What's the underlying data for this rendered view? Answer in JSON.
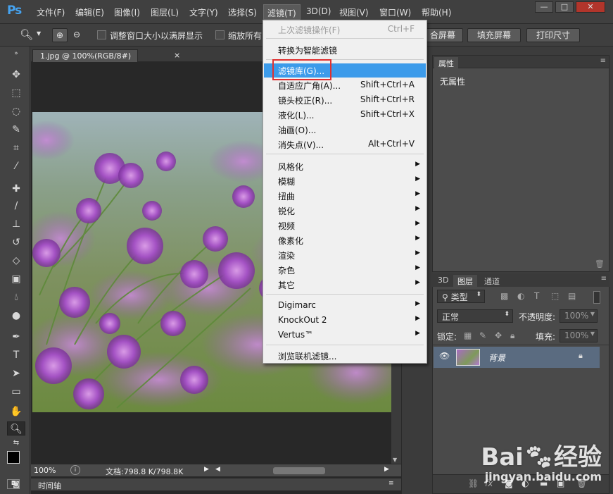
{
  "menubar": {
    "logo": "Ps",
    "items": [
      "文件(F)",
      "编辑(E)",
      "图像(I)",
      "图层(L)",
      "文字(Y)",
      "选择(S)",
      "滤镜(T)",
      "3D(D)",
      "视图(V)",
      "窗口(W)",
      "帮助(H)"
    ],
    "window_buttons": [
      "—",
      "□",
      "✕"
    ]
  },
  "options": {
    "check1_label": "调整窗口大小以满屏显示",
    "check2_label": "缩放所有",
    "btn_fit": "合屏幕",
    "btn_fill": "填充屏幕",
    "btn_print": "打印尺寸"
  },
  "document": {
    "tab_title": "1.jpg @ 100%(RGB/8#)",
    "tab_close": "×",
    "zoom": "100%",
    "doc_size": "文档:798.8 K/798.8K",
    "timeline_label": "时间轴"
  },
  "filter_menu": {
    "items": [
      {
        "label": "上次滤镜操作(F)",
        "shortcut": "Ctrl+F",
        "disabled": true
      },
      {
        "label": "转换为智能滤镜"
      },
      {
        "label": "滤镜库(G)..."
      },
      {
        "label": "自适应广角(A)...",
        "shortcut": "Shift+Ctrl+A"
      },
      {
        "label": "镜头校正(R)...",
        "shortcut": "Shift+Ctrl+R"
      },
      {
        "label": "液化(L)...",
        "shortcut": "Shift+Ctrl+X"
      },
      {
        "label": "油画(O)..."
      },
      {
        "label": "消失点(V)...",
        "shortcut": "Alt+Ctrl+V"
      },
      {
        "label": "风格化",
        "submenu": true
      },
      {
        "label": "模糊",
        "submenu": true
      },
      {
        "label": "扭曲",
        "submenu": true
      },
      {
        "label": "锐化",
        "submenu": true
      },
      {
        "label": "视频",
        "submenu": true
      },
      {
        "label": "像素化",
        "submenu": true
      },
      {
        "label": "渲染",
        "submenu": true
      },
      {
        "label": "杂色",
        "submenu": true
      },
      {
        "label": "其它",
        "submenu": true
      },
      {
        "label": "Digimarc",
        "submenu": true
      },
      {
        "label": "KnockOut 2",
        "submenu": true
      },
      {
        "label": "Vertus™",
        "submenu": true
      },
      {
        "label": "浏览联机滤镜..."
      }
    ]
  },
  "properties_panel": {
    "tab": "属性",
    "empty_text": "无属性"
  },
  "layers_panel": {
    "tabs": [
      "3D",
      "图层",
      "通道"
    ],
    "filter_kind": "类型",
    "blend_mode": "正常",
    "opacity_label": "不透明度:",
    "opacity_value": "100%",
    "lock_label": "锁定:",
    "fill_label": "填充:",
    "fill_value": "100%",
    "layer_name": "背景"
  },
  "watermark": {
    "brand": "Bai",
    "brand2": "经验",
    "url": "jingyan.baidu.com"
  },
  "colors": {
    "accent": "#3c9bea",
    "highlight_box": "#e03030",
    "ps_logo": "#46a3f0"
  }
}
